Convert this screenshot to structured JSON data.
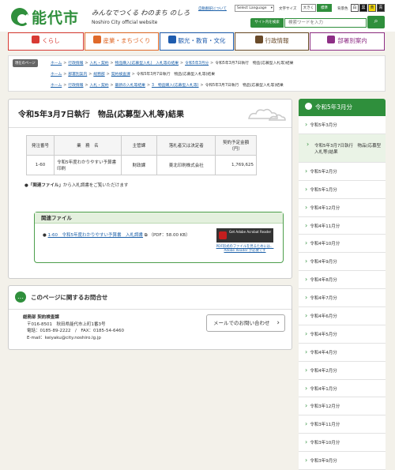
{
  "header": {
    "logo_text": "能代市",
    "tagline": "みんなでつくる わのまち のしろ",
    "official": "Noshiro City official website",
    "auto_translate": "自動翻訳について",
    "language_select": "Select Language",
    "font_size_label": "文字サイズ",
    "font_large": "大きく",
    "font_standard": "標準",
    "bg_label": "背景色",
    "bg_white": "白",
    "bg_black": "黒",
    "bg_yellow": "黄",
    "bg_blue": "青",
    "search_label": "サイト内を検索",
    "search_placeholder": "検索ワードを入力",
    "search_button_icon": "search-icon"
  },
  "global_nav": [
    {
      "label": "くらし",
      "color": "#d83a34"
    },
    {
      "label": "産業・まちづくり",
      "color": "#e06a2a"
    },
    {
      "label": "観光・教育・文化",
      "color": "#1e5cae"
    },
    {
      "label": "行政情報",
      "color": "#6a4b2a"
    },
    {
      "label": "部署別案内",
      "color": "#8e2f86"
    }
  ],
  "breadcrumb": {
    "tag": "現在のページ",
    "lines": [
      [
        "ホーム",
        "行政情報",
        "入札・契約",
        "物品購入(応募型入札)　入札等の結果",
        "令和5年3月分",
        "令和5年3月7日執行　物品(応募型入札等)結果"
      ],
      [
        "ホーム",
        "部署別案内",
        "総務部",
        "契約検査課",
        "令和5年3月7日執行　物品(応募型入札等)結果"
      ],
      [
        "ホーム",
        "行政情報",
        "入札・契約",
        "最新の入札等結果",
        "3　物品購入(応募型入札等)",
        "令和5年3月7日執行　物品(応募型入札等)結果"
      ]
    ]
  },
  "main": {
    "title": "令和5年3月7日執行　物品(応募型入札等)結果",
    "table": {
      "headers": [
        "発注番号",
        "業　務　名",
        "主管課",
        "落札者又は決定者",
        "契約予定金額\n（円）"
      ],
      "rows": [
        [
          "1-60",
          "令和5年度わかりやすい予算書印刷",
          "財政課",
          "東北印刷株式会社",
          "1,769,625"
        ]
      ]
    },
    "note_bold": "「関連ファイル」",
    "note_rest": "から入札調書をご覧いただけます",
    "related": {
      "heading": "関連ファイル",
      "link": "1-60　令和5年度わかりやすい予算書　入札調書",
      "size": "（PDF：58.00 KB）",
      "reader_banner": "Get Adobe Acrobat Reader",
      "reader_note": "PDF形式のファイルを見るためには、Adobe Reader が必要です"
    }
  },
  "contact": {
    "title": "このページに関するお問合せ",
    "dept": "総務部 契約検査課",
    "address": "〒016-8501　秋田県能代市上町1番3号",
    "tel": "電話：0185-89-2222　/　FAX：0185-54-6460",
    "email": "E-mail：keiyaku@city.noshiro.lg.jp",
    "mail_button": "メールでのお問い合わせ"
  },
  "side": {
    "heading": "令和5年3月分",
    "items": [
      {
        "label": "令和5年3月分",
        "sub": false
      },
      {
        "label": "令和5年3月7日執行　物品(応募型入札等)結果",
        "sub": true
      },
      {
        "label": "令和5年2月分",
        "sub": false
      },
      {
        "label": "令和5年1月分",
        "sub": false
      },
      {
        "label": "令和4年12月分",
        "sub": false
      },
      {
        "label": "令和4年11月分",
        "sub": false
      },
      {
        "label": "令和4年10月分",
        "sub": false
      },
      {
        "label": "令和4年9月分",
        "sub": false
      },
      {
        "label": "令和4年8月分",
        "sub": false
      },
      {
        "label": "令和4年7月分",
        "sub": false
      },
      {
        "label": "令和4年6月分",
        "sub": false
      },
      {
        "label": "令和4年5月分",
        "sub": false
      },
      {
        "label": "令和4年4月分",
        "sub": false
      },
      {
        "label": "令和4年2月分",
        "sub": false
      },
      {
        "label": "令和4年1月分",
        "sub": false
      },
      {
        "label": "令和3年12月分",
        "sub": false
      },
      {
        "label": "令和3年11月分",
        "sub": false
      },
      {
        "label": "令和3年10月分",
        "sub": false
      },
      {
        "label": "令和3年9月分",
        "sub": false
      }
    ]
  }
}
